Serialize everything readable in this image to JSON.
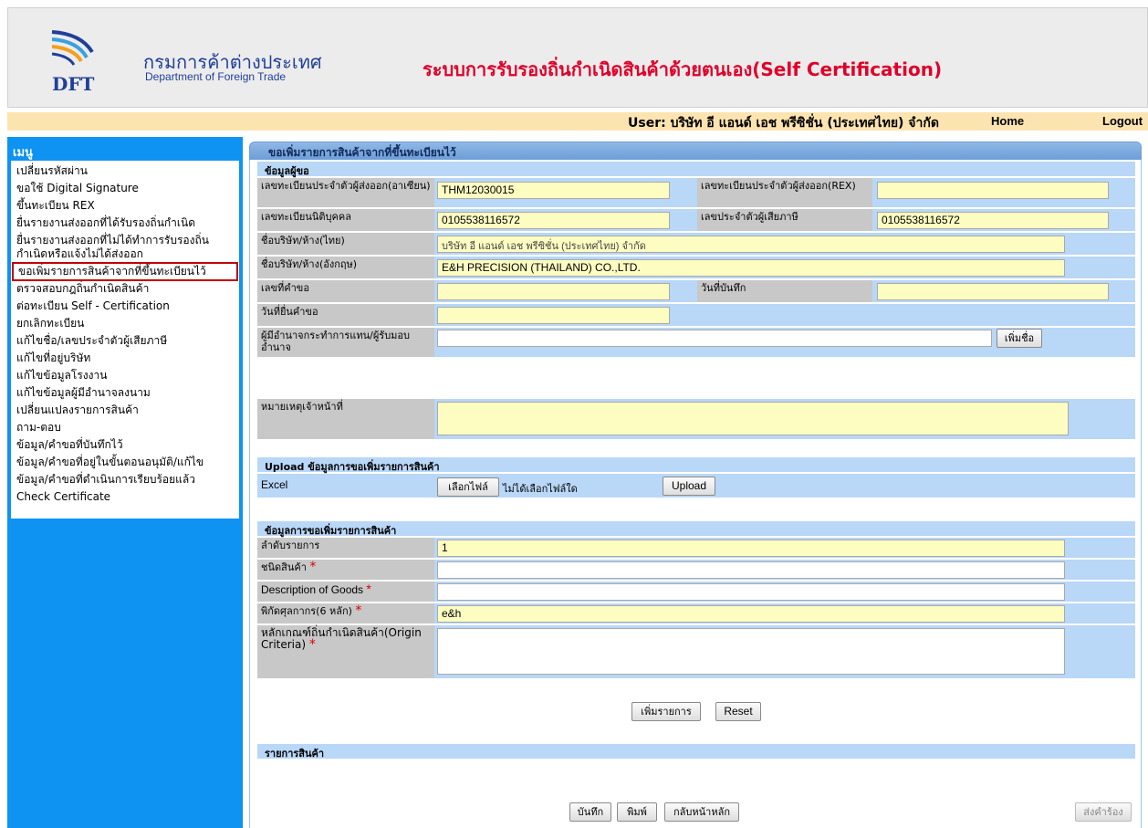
{
  "header": {
    "logo_text": "DFT",
    "org_name_th": "กรมการค้าต่างประเทศ",
    "org_name_en": "Department of Foreign Trade",
    "system_title": "ระบบการรับรองถิ่นกำเนิดสินค้าด้วยตนเอง(Self Certification)"
  },
  "userbar": {
    "user_text": "User: บริษัท อี แอนด์ เอช พรีซิชั่น (ประเทศไทย) จำกัด",
    "home": "Home",
    "logout": "Logout"
  },
  "sidebar": {
    "title": "เมนู",
    "items": [
      {
        "label": "เปลี่ยนรหัสผ่าน"
      },
      {
        "label": "ขอใช้ Digital Signature"
      },
      {
        "label": "ขึ้นทะเบียน REX"
      },
      {
        "label": "ยื่นรายงานส่งออกที่ได้รับรองถิ่นกำเนิด"
      },
      {
        "label": "ยื่นรายงานส่งออกที่ไม่ได้ทำการรับรองถิ่นกำเนิดหรือแจ้งไม่ได้ส่งออก"
      },
      {
        "label": "ขอเพิ่มรายการสินค้าจากที่ขึ้นทะเบียนไว้"
      },
      {
        "label": "ตรวจสอบกฎถิ่นกำเนิดสินค้า"
      },
      {
        "label": "ต่อทะเบียน Self - Certification"
      },
      {
        "label": "ยกเลิกทะเบียน"
      },
      {
        "label": "แก้ไขชื่อ/เลขประจำตัวผู้เสียภาษี"
      },
      {
        "label": "แก้ไขที่อยู่บริษัท"
      },
      {
        "label": "แก้ไขข้อมูลโรงงาน"
      },
      {
        "label": "แก้ไขข้อมูลผู้มีอำนาจลงนาม"
      },
      {
        "label": "เปลี่ยนแปลงรายการสินค้า"
      },
      {
        "label": "ถาม-ตอบ"
      },
      {
        "label": "ข้อมูล/คำขอที่บันทึกไว้"
      },
      {
        "label": "ข้อมูล/คำขอที่อยู่ในขั้นตอนอนุมัติ/แก้ไข"
      },
      {
        "label": "ข้อมูล/คำขอที่ดำเนินการเรียบร้อยแล้ว"
      },
      {
        "label": "Check Certificate"
      }
    ]
  },
  "main": {
    "title": "ขอเพิ่มรายการสินค้าจากที่ขึ้นทะเบียนไว้",
    "applicant": {
      "heading": "ข้อมูลผู้ขอ",
      "exporter_reg_asean_label": "เลขทะเบียนประจำตัวผู้ส่งออก(อาเซียน)",
      "exporter_reg_asean_value": "THM12030015",
      "exporter_reg_rex_label": "เลขทะเบียนประจำตัวผู้ส่งออก(REX)",
      "exporter_reg_rex_value": "",
      "juristic_label": "เลขทะเบียนนิติบุคคล",
      "juristic_value": "0105538116572",
      "taxpayer_label": "เลขประจำตัวผู้เสียภาษี",
      "taxpayer_value": "0105538116572",
      "company_th_label": "ชื่อบริษัท/ห้าง(ไทย)",
      "company_th_value": "บริษัท อี แอนด์ เอช พรีซิชั่น (ประเทศไทย) จำกัด",
      "company_en_label": "ชื่อบริษัท/ห้าง(อังกฤษ)",
      "company_en_value": "E&H PRECISION (THAILAND) CO.,LTD.",
      "request_no_label": "เลขที่คำขอ",
      "request_no_value": "",
      "record_date_label": "วันที่บันทึก",
      "record_date_value": "",
      "submit_date_label": "วันที่ยื่นคำขอ",
      "submit_date_value": "",
      "authorized_label": "ผู้มีอำนาจกระทำการแทน/ผู้รับมอบอำนาจ",
      "authorized_value": "",
      "add_name_button": "เพิ่มชื่อ",
      "officer_note_label": "หมายเหตุเจ้าหน้าที่",
      "officer_note_value": ""
    },
    "upload": {
      "heading": "Upload ข้อมูลการขอเพิ่มรายการสินค้า",
      "excel_label": "Excel",
      "choose_file_button": "เลือกไฟล์",
      "no_file_text": "ไม่ได้เลือกไฟล์ใด",
      "upload_button": "Upload"
    },
    "product_request": {
      "heading": "ข้อมูลการขอเพิ่มรายการสินค้า",
      "seq_label": "ลำดับรายการ",
      "seq_value": "1",
      "product_type_label": "ชนิดสินค้า",
      "product_type_value": "",
      "description_label": "Description of Goods",
      "description_value": "",
      "hs_code_label": "พิกัดศุลกากร(6 หลัก)",
      "hs_code_value": "e&h",
      "origin_criteria_label": "หลักเกณฑ์ถิ่นกำเนิดสินค้า(Origin Criteria)",
      "origin_criteria_value": "",
      "required_mark": "*",
      "add_item_button": "เพิ่มรายการ",
      "reset_button": "Reset"
    },
    "product_list": {
      "heading": "รายการสินค้า"
    },
    "footer": {
      "save_button": "บันทึก",
      "print_button": "พิมพ์",
      "back_button": "กลับหน้าหลัก",
      "submit_button": "ส่งคำร้อง"
    }
  }
}
